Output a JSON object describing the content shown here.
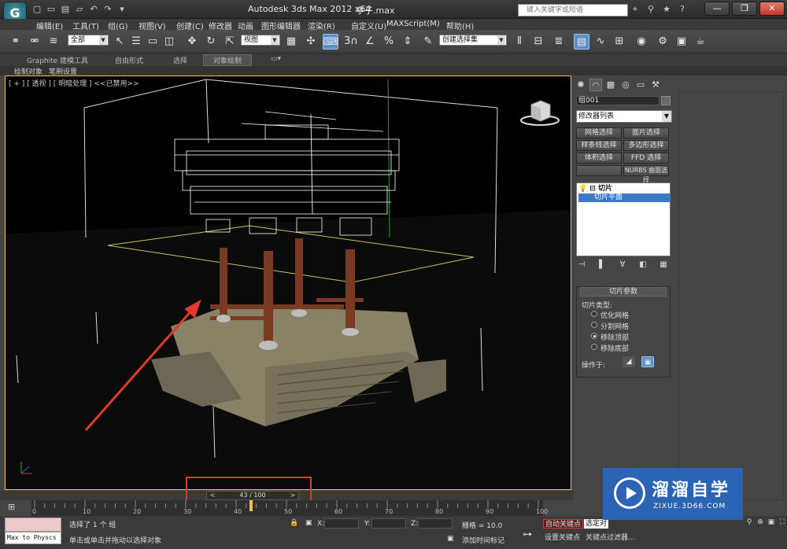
{
  "app": {
    "logo_glyph": "G",
    "title": "Autodesk 3ds Max  2012 x64",
    "file": "亭子.max",
    "search_placeholder": "键入关键字或短语",
    "win_controls": [
      "—",
      "❐",
      "✕"
    ]
  },
  "quick_access": [
    "▢",
    "▭",
    "▤",
    "▱",
    "↶",
    "↷",
    "▾"
  ],
  "title_icons": [
    "⌖",
    "⚲",
    "★",
    "?"
  ],
  "menu": [
    "编辑(E)",
    "工具(T)",
    "组(G)",
    "视图(V)",
    "创建(C)",
    "修改器",
    "动画",
    "图形编辑器",
    "渲染(R)",
    "自定义(U)",
    "MAXScript(M)",
    "帮助(H)"
  ],
  "toolbar": {
    "selection_filter": "全部",
    "ref_coord": "视图",
    "named_selection": "创建选择集",
    "icons": [
      "link-icon",
      "unlink-icon",
      "bind-icon",
      "select-icon",
      "select-by-name-icon",
      "rect-region-icon",
      "window-crossing-icon",
      "move-icon",
      "rotate-icon",
      "scale-icon",
      "pivot-icon",
      "select-manipulate-icon",
      "keyboard-shortcut-icon",
      "snap-3-icon",
      "angle-snap-icon",
      "percent-snap-icon",
      "spinner-snap-icon",
      "edit-named-sel-icon",
      "mirror-icon",
      "align-icon",
      "layer-manager-icon",
      "graphite-toggle-icon",
      "curve-editor-icon",
      "schematic-icon",
      "material-editor-icon",
      "render-setup-icon",
      "render-frame-icon",
      "quick-render-icon"
    ]
  },
  "ribbon": {
    "tabs": [
      "Graphite 建模工具",
      "自由形式",
      "选择",
      "对象绘制"
    ],
    "active": "对象绘制",
    "sub": [
      "绘制对象",
      "笔刷设置"
    ]
  },
  "viewport": {
    "label": "[ + ] [ 透视 ] [ 明暗处理 ] <<已禁用>>"
  },
  "command_panel": {
    "tab_icons": [
      "✺",
      "◠",
      "▦",
      "◎",
      "▭",
      "⚒"
    ],
    "object_name": "组001",
    "modifier_list": "修改器列表",
    "mod_buttons": [
      "网格选择",
      "面片选择",
      "样条线选择",
      "多边形选择",
      "体积选择",
      "FFD 选择",
      "",
      "NURBS 曲面选择"
    ],
    "stack": [
      "切片",
      "切片平面"
    ],
    "stack_tools": [
      "⊣",
      "▌",
      "∀",
      "◧",
      "▦"
    ],
    "rollout_title": "切片参数",
    "slice_type_label": "切片类型:",
    "slice_options": [
      "优化网格",
      "分割网格",
      "移除顶部",
      "移除底部"
    ],
    "slice_selected": "移除顶部",
    "operate_on": "操作于:"
  },
  "timeline": {
    "frame_display": "43 / 100",
    "current_frame": 43,
    "total_frames": 100,
    "tick_labels": [
      "0",
      "10",
      "20",
      "30",
      "40",
      "50",
      "60",
      "70",
      "80",
      "90",
      "100"
    ]
  },
  "status": {
    "maxscript": "Max to Physcs (",
    "selection": "选择了 1 个 组",
    "prompt": "单击或单击并拖动以选择对象",
    "x_label": "X:",
    "y_label": "Y:",
    "z_label": "Z:",
    "grid": "栅格 = 10.0",
    "add_tag": "添加时间标记",
    "auto_key": "自动关键点",
    "selected": "选定对",
    "set_key": "设置关键点",
    "key_filters": "关键点过滤器..."
  },
  "watermark": {
    "title": "溜溜自学",
    "sub": "ZIXUE.3D66.COM"
  },
  "colors": {
    "viewport_border": "#e8c440",
    "arrow": "#e03a2a",
    "highlight_box": "#e03a2a",
    "pillar": "#7a3a22",
    "stone": "#8a8266",
    "slice_plane": "#c9c060"
  }
}
